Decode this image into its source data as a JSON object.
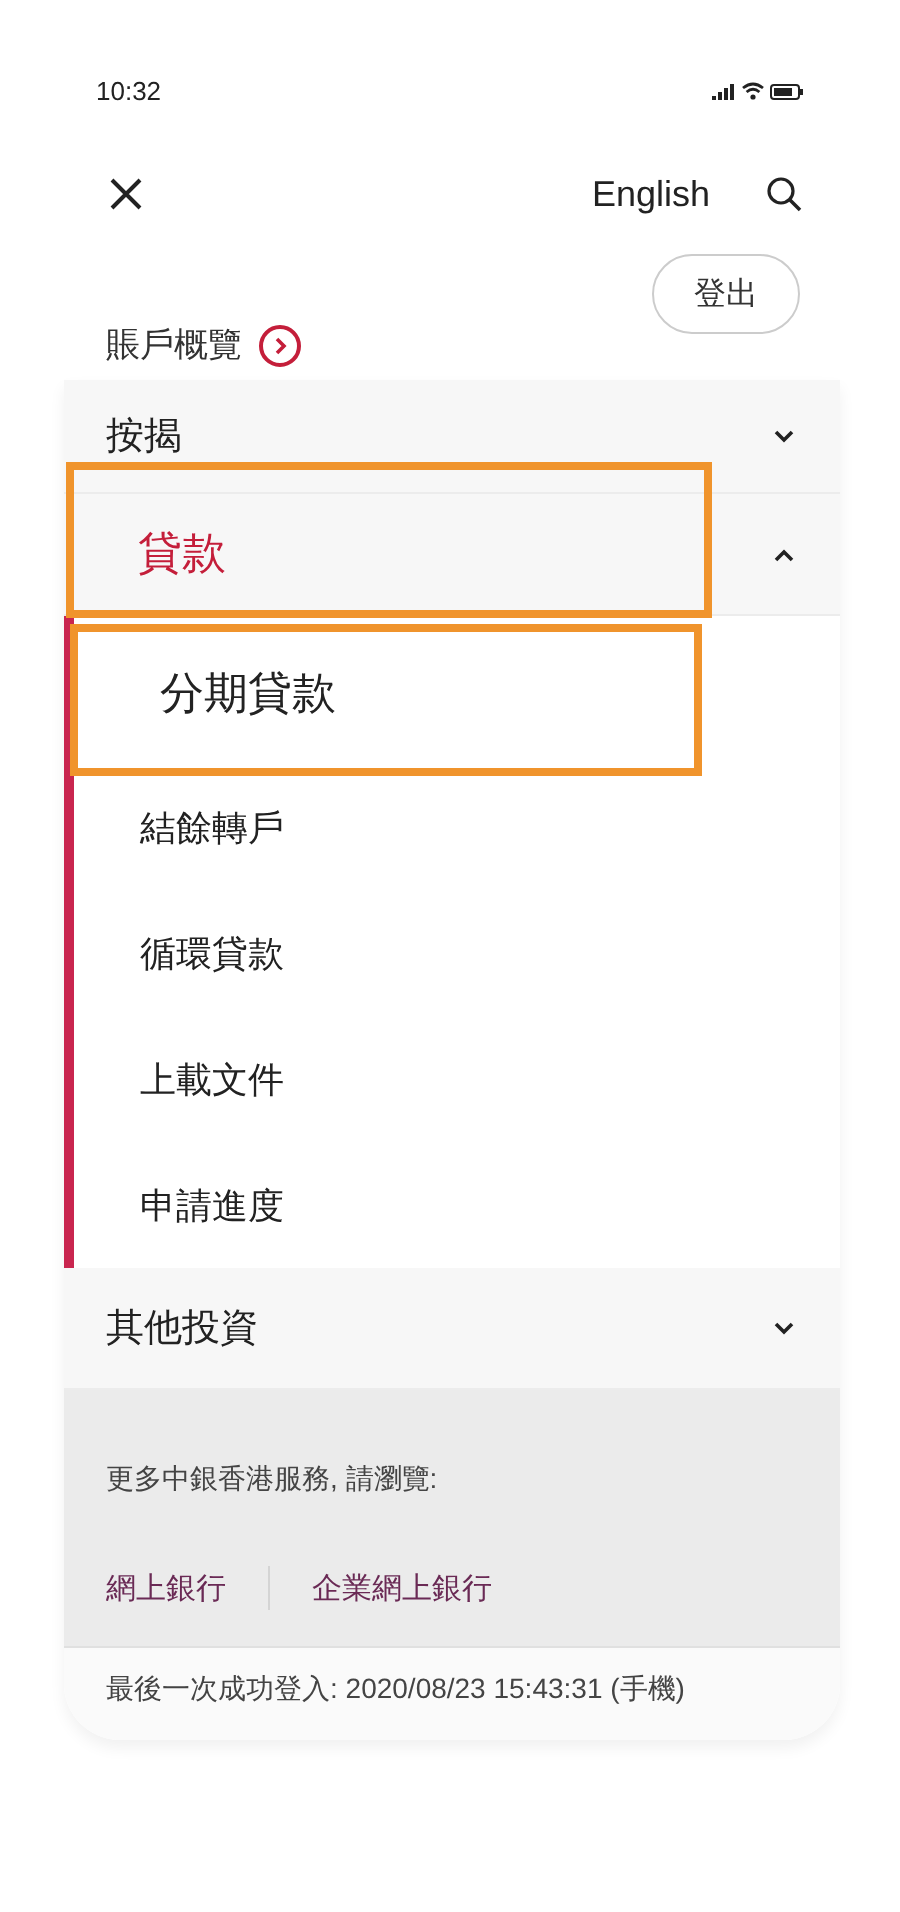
{
  "status_bar": {
    "time": "10:32"
  },
  "header": {
    "language": "English"
  },
  "logout": {
    "label": "登出"
  },
  "account_overview": {
    "label": "賬戶概覽"
  },
  "menu": [
    {
      "label": "按揭",
      "selected": false,
      "expanded": false,
      "highlighted": false
    },
    {
      "label": "貸款",
      "selected": true,
      "expanded": true,
      "highlighted": true,
      "children": [
        {
          "label": "分期貸款",
          "highlighted": true
        },
        {
          "label": "結餘轉戶",
          "highlighted": false
        },
        {
          "label": "循環貸款",
          "highlighted": false
        },
        {
          "label": "上載文件",
          "highlighted": false
        },
        {
          "label": "申請進度",
          "highlighted": false
        }
      ]
    },
    {
      "label": "其他投資",
      "selected": false,
      "expanded": false,
      "highlighted": false
    }
  ],
  "more_services": {
    "text": "更多中銀香港服務, 請瀏覽:",
    "links": [
      "網上銀行",
      "企業網上銀行"
    ]
  },
  "last_login": "最後一次成功登入: 2020/08/23 15:43:31 (手機)"
}
